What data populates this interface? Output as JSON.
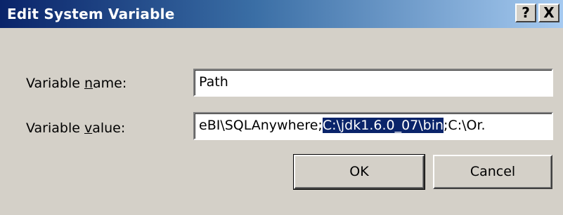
{
  "window": {
    "title": "Edit System Variable",
    "help_label": "?",
    "close_label": "X"
  },
  "form": {
    "name_label_prefix": "Variable ",
    "name_label_accel": "n",
    "name_label_suffix": "ame:",
    "name_value": "Path",
    "value_label_prefix": "Variable ",
    "value_label_accel": "v",
    "value_label_suffix": "alue:",
    "value_before_selection": "eBI\\SQLAnywhere;",
    "value_selection": "C:\\jdk1.6.0_07\\bin",
    "value_after_selection": ";C:\\Or."
  },
  "buttons": {
    "ok_label": "OK",
    "cancel_label": "Cancel"
  },
  "colors": {
    "titlebar_start": "#0a246a",
    "titlebar_end": "#a6caf0",
    "face": "#d4d0c8",
    "selection": "#0a246a"
  },
  "icons": {
    "help": "help-question-icon",
    "close": "close-icon"
  }
}
